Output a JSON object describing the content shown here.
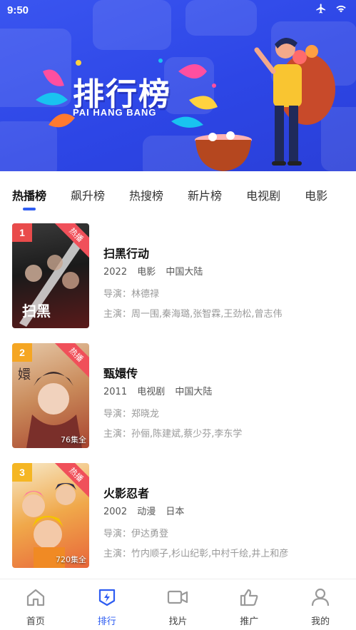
{
  "status": {
    "time": "9:50"
  },
  "banner": {
    "title": "排行榜",
    "subtitle": "PAI HANG BANG"
  },
  "tabs": [
    {
      "label": "热播榜",
      "active": true
    },
    {
      "label": "飙升榜"
    },
    {
      "label": "热搜榜"
    },
    {
      "label": "新片榜"
    },
    {
      "label": "电视剧"
    },
    {
      "label": "电影"
    }
  ],
  "items": [
    {
      "rank": "1",
      "badge": "热播",
      "title": "扫黑行动",
      "year": "2022",
      "genre": "电影",
      "region": "中国大陆",
      "director": "导演：林德禄",
      "cast": "主演：周一围,秦海璐,张智霖,王劲松,曾志伟",
      "episodes": "",
      "rank_color": "#e94b4b"
    },
    {
      "rank": "2",
      "badge": "热播",
      "title": "甄嬛传",
      "year": "2011",
      "genre": "电视剧",
      "region": "中国大陆",
      "director": "导演：郑晓龙",
      "cast": "主演：孙俪,陈建斌,蔡少芬,李东学",
      "episodes": "76集全",
      "rank_color": "#f5a623"
    },
    {
      "rank": "3",
      "badge": "热播",
      "title": "火影忍者",
      "year": "2002",
      "genre": "动漫",
      "region": "日本",
      "director": "导演：伊达勇登",
      "cast": "主演：竹内顺子,杉山纪彰,中村千绘,井上和彦",
      "episodes": "720集全",
      "rank_color": "#f5b623"
    }
  ],
  "nav": [
    {
      "label": "首页",
      "icon": "home-icon"
    },
    {
      "label": "排行",
      "icon": "ranking-icon",
      "active": true
    },
    {
      "label": "找片",
      "icon": "video-camera-icon"
    },
    {
      "label": "推广",
      "icon": "thumbs-up-icon"
    },
    {
      "label": "我的",
      "icon": "user-icon"
    }
  ],
  "colors": {
    "accent": "#2e5df2",
    "banner": "#2d46e6",
    "hot": "#f0505a"
  }
}
